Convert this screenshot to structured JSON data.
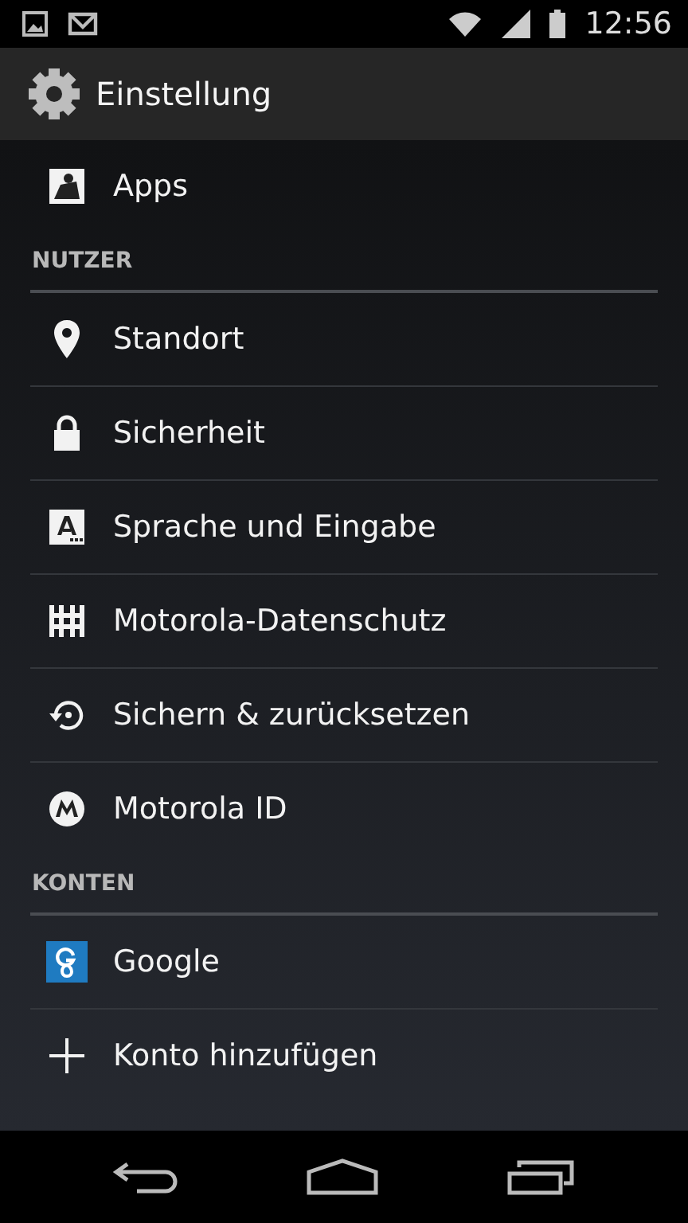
{
  "status_bar": {
    "time": "12:56"
  },
  "action_bar": {
    "title": "Einstellung"
  },
  "list": [
    {
      "kind": "item",
      "label": "Apps"
    },
    {
      "kind": "header",
      "label": "NUTZER"
    },
    {
      "kind": "item",
      "label": "Standort"
    },
    {
      "kind": "item",
      "label": "Sicherheit"
    },
    {
      "kind": "item",
      "label": "Sprache und Eingabe"
    },
    {
      "kind": "item",
      "label": "Motorola-Datenschutz"
    },
    {
      "kind": "item",
      "label": "Sichern & zurücksetzen"
    },
    {
      "kind": "item",
      "label": "Motorola ID"
    },
    {
      "kind": "header",
      "label": "KONTEN"
    },
    {
      "kind": "item",
      "label": "Google"
    },
    {
      "kind": "item",
      "label": "Konto hinzufügen"
    }
  ]
}
